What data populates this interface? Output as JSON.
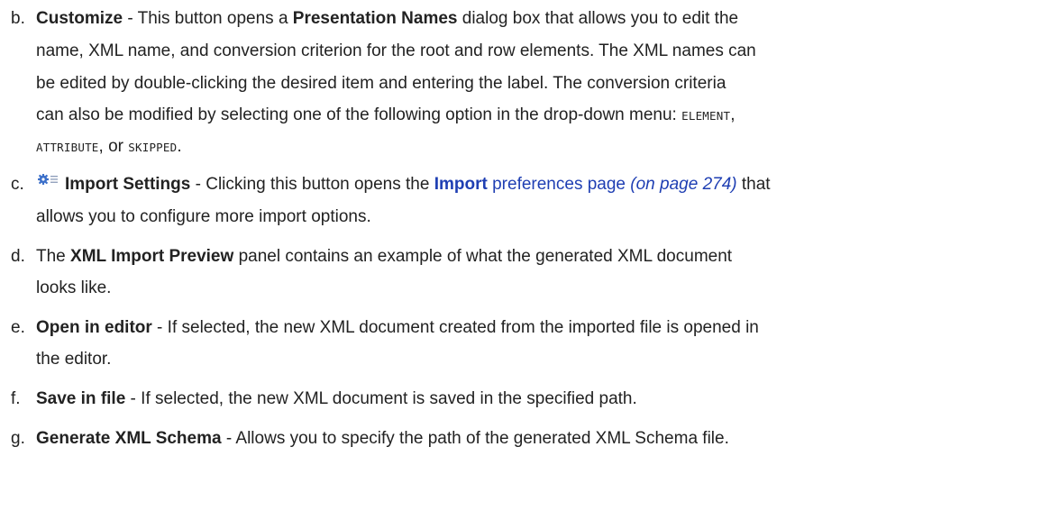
{
  "items": {
    "b": {
      "marker": "b.",
      "term": "Customize",
      "text1": " - This button opens a ",
      "dialog_name": "Presentation Names",
      "text2": " dialog box that allows you to edit the",
      "line2": "name, XML name, and conversion criterion for the root and row elements. The XML names can",
      "line3": "be edited by double-clicking the desired item and entering the label. The conversion criteria",
      "line4_text": "can also be modified by selecting one of the following option in the drop-down menu: ",
      "option_element": "ELEMENT",
      "comma": ",",
      "option_attribute": "ATTRIBUTE",
      "or_text": ", or ",
      "option_skipped": "SKIPPED",
      "period": "."
    },
    "c": {
      "marker": "c.",
      "icon": "settings-icon",
      "term": "Import Settings",
      "text1": " - Clicking this button opens the ",
      "link_bold": "Import",
      "link_text": " preferences page",
      "page_ref": " (on page 274)",
      "text2": " that",
      "line2": "allows you to configure more import options."
    },
    "d": {
      "marker": "d.",
      "text1": "The ",
      "term": "XML Import Preview",
      "text2": " panel contains an example of what the generated XML document",
      "line2": "looks like."
    },
    "e": {
      "marker": "e.",
      "term": "Open in editor",
      "text1": " - If selected, the new XML document created from the imported file is opened in",
      "line2": "the editor."
    },
    "f": {
      "marker": "f.",
      "term": "Save in file",
      "text1": " - If selected, the new XML document is saved in the specified path."
    },
    "g": {
      "marker": "g.",
      "term": "Generate XML Schema",
      "text1": " - Allows you to specify the path of the generated XML Schema file."
    }
  },
  "colors": {
    "text": "#222222",
    "link": "#1f3fb3",
    "icon": "#3b6fc9"
  }
}
